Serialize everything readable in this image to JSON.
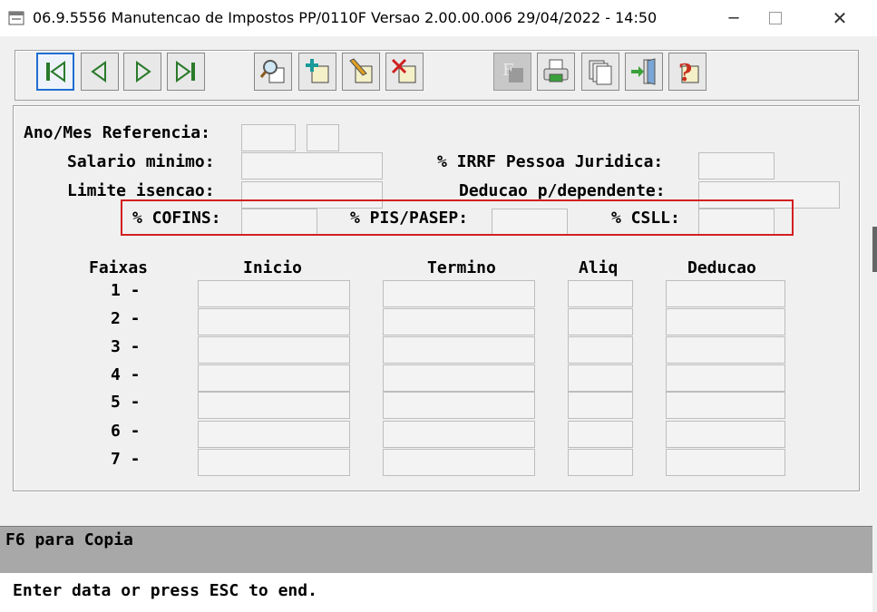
{
  "window": {
    "title": "06.9.5556 Manutencao  de Impostos PP/0110F Versao 2.00.00.006 29/04/2022 - 14:50",
    "controls": {
      "minimize": "─",
      "maximize": "☐",
      "close": "✕"
    }
  },
  "toolbar": {
    "nav_buttons": [
      "first-record-icon",
      "previous-record-icon",
      "next-record-icon",
      "last-record-icon"
    ],
    "edit_buttons": [
      "search-icon",
      "add-record-icon",
      "edit-record-icon",
      "delete-record-icon"
    ],
    "util_buttons": [
      "filter-icon",
      "print-icon",
      "copy-icon",
      "exit-icon",
      "help-icon"
    ],
    "accent": "#1f6fd1"
  },
  "form": {
    "ano_mes_label": "Ano/Mes Referencia:",
    "ano_value": "",
    "mes_value": "",
    "salario_label": "Salario minimo:",
    "salario_value": "",
    "irrf_label": "% IRRF Pessoa Juridica:",
    "irrf_value": "",
    "limite_label": "Limite isencao:",
    "limite_value": "",
    "deducao_dep_label": "Deducao p/dependente:",
    "deducao_dep_value": "",
    "cofins_label": "% COFINS:",
    "cofins_value": "",
    "pis_label": "% PIS/PASEP:",
    "pis_value": "",
    "csll_label": "% CSLL:",
    "csll_value": "",
    "highlight_color": "#d31f1f"
  },
  "faixas": {
    "headers": {
      "faixas": "Faixas",
      "inicio": "Inicio",
      "termino": "Termino",
      "aliq": "Aliq",
      "deducao": "Deducao"
    },
    "rows": [
      {
        "label": "1 -",
        "inicio": "",
        "termino": "",
        "aliq": "",
        "deducao": ""
      },
      {
        "label": "2 -",
        "inicio": "",
        "termino": "",
        "aliq": "",
        "deducao": ""
      },
      {
        "label": "3 -",
        "inicio": "",
        "termino": "",
        "aliq": "",
        "deducao": ""
      },
      {
        "label": "4 -",
        "inicio": "",
        "termino": "",
        "aliq": "",
        "deducao": ""
      },
      {
        "label": "5 -",
        "inicio": "",
        "termino": "",
        "aliq": "",
        "deducao": ""
      },
      {
        "label": "6 -",
        "inicio": "",
        "termino": "",
        "aliq": "",
        "deducao": ""
      },
      {
        "label": "7 -",
        "inicio": "",
        "termino": "",
        "aliq": "",
        "deducao": ""
      }
    ]
  },
  "message_bar": {
    "text": "F6 para Copia"
  },
  "status_bar": {
    "text": "Enter data or press ESC to end."
  }
}
